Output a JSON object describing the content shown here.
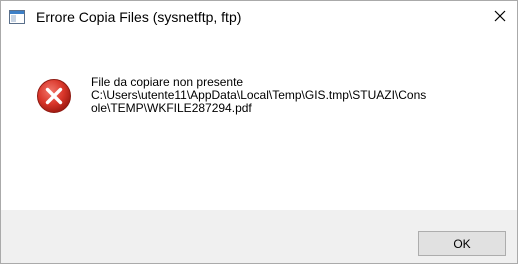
{
  "window": {
    "title": "Errore Copia Files (sysnetftp, ftp)",
    "title_icon": "application-window-icon",
    "close_icon": "close-icon"
  },
  "message": {
    "icon": "error-icon",
    "line1": "File da copiare non presente",
    "line2": "C:\\Users\\utente11\\AppData\\Local\\Temp\\GIS.tmp\\STUAZI\\Cons",
    "line3": "ole\\TEMP\\WKFILE287294.pdf"
  },
  "buttons": {
    "ok_label": "OK"
  },
  "colors": {
    "error_red": "#c42b1c",
    "footer_bg": "#f0f0f0",
    "button_bg": "#e1e1e1"
  }
}
